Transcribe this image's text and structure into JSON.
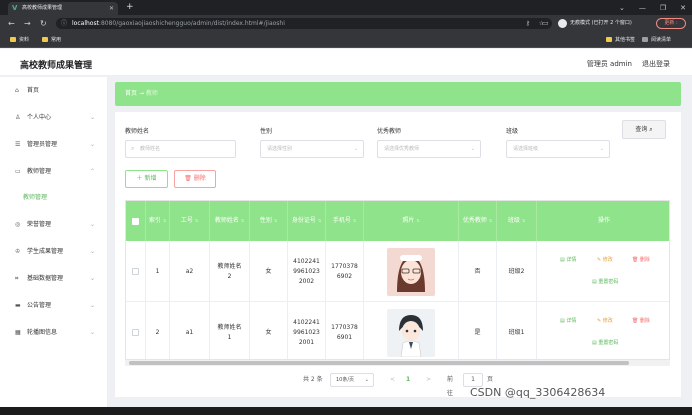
{
  "browser": {
    "tab_title": "高校教师成果管理",
    "tab_favicon": "V",
    "new_tab": "+",
    "url_host": "localhost",
    "url_path": ":8080/gaoxiaojiaoshichengguo/admin/dist/index.html#/jiaoshi",
    "incognito_label": "无痕模式 (已打开 2 个窗口)",
    "update_label": "更新 :",
    "bookmarks": [
      "资料",
      "常用"
    ],
    "bookmarks_right": [
      "其他书签",
      "阅读清单"
    ]
  },
  "header": {
    "title": "高校教师成果管理",
    "user_label": "管理员 admin",
    "logout_label": "退出登录"
  },
  "sidebar": {
    "items": [
      {
        "label": "首页",
        "icon": "home-icon",
        "glyph": "⌂",
        "chevron": false
      },
      {
        "label": "个人中心",
        "icon": "user-icon",
        "glyph": "♙",
        "chevron": true
      },
      {
        "label": "管理员管理",
        "icon": "sliders-icon",
        "glyph": "☰",
        "chevron": true
      },
      {
        "label": "教师管理",
        "icon": "message-icon",
        "glyph": "▭",
        "chevron": true
      }
    ],
    "sub_item": "教师管理",
    "items_after": [
      {
        "label": "荣誉管理",
        "icon": "medal-icon",
        "glyph": "◎",
        "chevron": true
      },
      {
        "label": "学生成果管理",
        "icon": "trophy-icon",
        "glyph": "♔",
        "chevron": true
      },
      {
        "label": "基础数据管理",
        "icon": "crop-icon",
        "glyph": "⌗",
        "chevron": true
      },
      {
        "label": "公告管理",
        "icon": "notice-icon",
        "glyph": "▬",
        "chevron": true
      },
      {
        "label": "轮播图信息",
        "icon": "grid-icon",
        "glyph": "▦",
        "chevron": true
      }
    ]
  },
  "breadcrumb": {
    "home": "首页",
    "sep": "→",
    "current": "教师"
  },
  "filters": {
    "name": {
      "label": "教师姓名",
      "placeholder": "教师姓名"
    },
    "gender": {
      "label": "性别",
      "placeholder": "请选择性别"
    },
    "excellent": {
      "label": "优秀教师",
      "placeholder": "请选择优秀教师"
    },
    "class": {
      "label": "班级",
      "placeholder": "请选择班级"
    },
    "query_label": "查询 ⌕"
  },
  "actions": {
    "add_label": "＋ 新增",
    "delete_label": "🗑 删除"
  },
  "table": {
    "headers": [
      "索引",
      "工号",
      "教师姓名",
      "性别",
      "身份证号",
      "手机号",
      "照片",
      "优秀教师",
      "班级",
      "操作"
    ],
    "rows": [
      {
        "index": "1",
        "job_no": "a2",
        "name": "教师姓名\n2",
        "gender": "女",
        "id_card": "4102241\n9961023\n2002",
        "phone": "1770378\n6902",
        "excellent": "否",
        "class": "班级2",
        "photo_color": "#f3d9d2"
      },
      {
        "index": "2",
        "job_no": "a1",
        "name": "教师姓名\n1",
        "gender": "女",
        "id_card": "4102241\n9961023\n2001",
        "phone": "1770378\n6901",
        "excellent": "是",
        "class": "班级1",
        "photo_color": "#eef2f5"
      }
    ],
    "op_labels": {
      "detail": "▤ 详情",
      "edit": "✎ 修改",
      "delete": "🗑 删除",
      "reset": "▤ 重置密码"
    }
  },
  "pagination": {
    "total": "共 2 条",
    "page_size": "10条/页",
    "page_size_arrow": "⌄",
    "prev": "<",
    "current": "1",
    "next": ">",
    "goto_label": "前往",
    "goto_value": "1",
    "unit": "页"
  },
  "watermark": "CSDN @qq_3306428634"
}
